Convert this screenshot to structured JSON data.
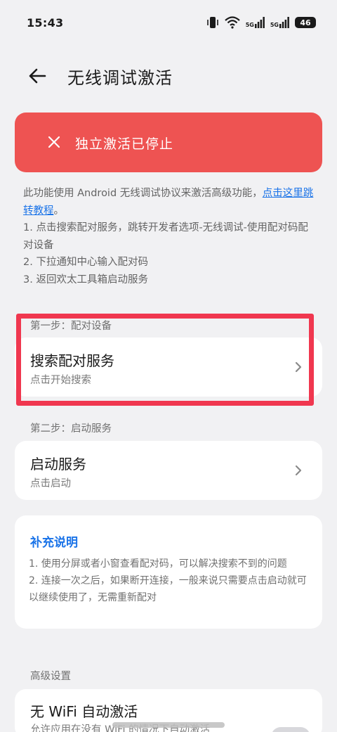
{
  "status_bar": {
    "time": "15:43",
    "net1": "5G",
    "net2": "5G",
    "battery": "46"
  },
  "header": {
    "title": "无线调试激活"
  },
  "alert": {
    "text": "独立激活已停止",
    "color": "#ee5352"
  },
  "description": {
    "intro": "此功能使用 Android 无线调试协议来激活高级功能，",
    "link": "点击这里跳转教程",
    "period": "。",
    "steps": [
      "1. 点击搜索配对服务，跳转开发者选项-无线调试-使用配对码配对设备",
      "2. 下拉通知中心输入配对码",
      "3. 返回欢太工具箱启动服务"
    ]
  },
  "step1": {
    "label": "第一步：配对设备",
    "title": "搜索配对服务",
    "subtitle": "点击开始搜索"
  },
  "step2": {
    "label": "第二步：启动服务",
    "title": "启动服务",
    "subtitle": "点击启动"
  },
  "notes": {
    "title": "补充说明",
    "lines": [
      "1. 使用分屏或者小窗查看配对码，可以解决搜索不到的问题",
      "2. 连接一次之后，如果断开连接，一般来说只需要点击启动就可以继续使用了，无需重新配对"
    ]
  },
  "advanced": {
    "label": "高级设置",
    "title": "无 WiFi 自动激活",
    "subtitle": "允许应用在没有 WiFi 的情况下自动激活"
  },
  "colors": {
    "accent": "#1a73e8",
    "highlight": "#f0374f"
  }
}
